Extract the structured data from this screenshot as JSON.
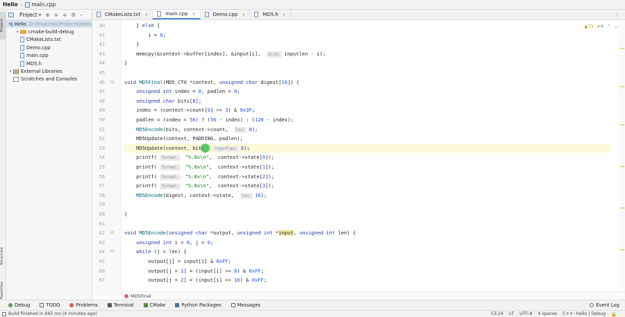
{
  "navbar": {
    "project": "Hello",
    "file": "main.cpp"
  },
  "sidebar_tabs": {
    "project": "Project",
    "structure": "Structure",
    "favorites": "Favorites"
  },
  "project_panel": {
    "title": "Project",
    "tree": [
      {
        "label": "Hello",
        "hint": "D:\\Projects\\CProjects\\Hello",
        "icon": "folder-icon",
        "level": 0,
        "arrow": "▾"
      },
      {
        "label": "cmake-build-debug",
        "icon": "folder-orange-icon",
        "level": 1,
        "arrow": "▸"
      },
      {
        "label": "CMakeLists.txt",
        "icon": "cmake-file-icon",
        "level": 1,
        "arrow": ""
      },
      {
        "label": "Demo.cpp",
        "icon": "cpp-file-icon",
        "level": 1,
        "arrow": ""
      },
      {
        "label": "main.cpp",
        "icon": "cpp-file-icon",
        "level": 1,
        "arrow": ""
      },
      {
        "label": "MD5.h",
        "icon": "header-file-icon",
        "level": 1,
        "arrow": ""
      },
      {
        "label": "External Libraries",
        "icon": "library-icon",
        "level": 0,
        "arrow": "▸"
      },
      {
        "label": "Scratches and Consoles",
        "icon": "scratch-icon",
        "level": 0,
        "arrow": ""
      }
    ]
  },
  "tabs": [
    {
      "label": "CMakeLists.txt",
      "active": false
    },
    {
      "label": "main.cpp",
      "active": true
    },
    {
      "label": "Demo.cpp",
      "active": false
    },
    {
      "label": "MD5.h",
      "active": false
    }
  ],
  "inspections": {
    "warnings": "▲73",
    "ok": "✔6"
  },
  "editor": {
    "line_numbers": [
      "40",
      "41",
      "42",
      "43",
      "44",
      "45",
      "46",
      "47",
      "48",
      "49",
      "50",
      "51",
      "52",
      "53",
      "54",
      "55",
      "56",
      "57",
      "58",
      "59",
      "60",
      "61",
      "62",
      "63",
      "64",
      "65",
      "66",
      "67"
    ],
    "hints": {
      "size": "Size:",
      "len": "len:",
      "inputlen": "inputlen:",
      "format": "format:"
    },
    "code_lines": [
      "    } else {",
      "        i = 0;",
      "    }",
      "    memcpy(&context->buffer[index], &input[i],  inputlen - i);",
      "}",
      "",
      "void MD5Final(MD5_CTX *context, unsigned char digest[16]) {",
      "    unsigned int index = 0, padlen = 0;",
      "    unsigned char bits[8];",
      "    index = (context->count[0] >> 3) & 0x3F;",
      "    padlen = (index < 56) ? (56 - index) : (120 - index);",
      "    MD5Encode(bits, context->count,  8);",
      "    MD5Update(context, PADDING, padlen);",
      "    MD5Update(context, bits,  8);",
      "    printf( \"%.8x\\n\",  context->state[0]);",
      "    printf( \"%.8x\\n\",  context->state[1]);",
      "    printf( \"%.8x\\n\",  context->state[2]);",
      "    printf( \"%.8x\\n\",  context->state[3]);",
      "    MD5Encode(digest, context->state,  16);",
      "",
      "}",
      "",
      "void MD5Encode(unsigned char *output, unsigned int *input, unsigned int len) {",
      "    unsigned int i = 0, j = 0;",
      "    while (j < len) {",
      "        output[j] = input[i] & 0xFF;",
      "        output[j + 1] = (input[i] >> 8) & 0xFF;",
      "        output[j + 2] = (input[i] >> 16) & 0xFF;"
    ],
    "breadcrumb": "MD5Final"
  },
  "toolwindows": [
    {
      "label": "Debug",
      "icon": "debug-icon"
    },
    {
      "label": "TODO",
      "icon": "todo-icon"
    },
    {
      "label": "Problems",
      "icon": "problems-icon"
    },
    {
      "label": "Terminal",
      "icon": "terminal-icon"
    },
    {
      "label": "CMake",
      "icon": "cmake-icon"
    },
    {
      "label": "Python Packages",
      "icon": "python-packages-icon"
    },
    {
      "label": "Messages",
      "icon": "messages-icon"
    }
  ],
  "event_log": "Event Log",
  "status": {
    "message": "Build finished in 665 ms (4 minutes ago)",
    "position": "53:24",
    "line_sep": "LF",
    "encoding": "UTF-8",
    "indent": "4 spaces",
    "context": "C++: Hello | Debug"
  },
  "colors": {
    "accent": "#4a88d8",
    "caret_marker": "#3fbd57",
    "keyword": "#1f34a8",
    "number": "#1750eb",
    "string": "#067d17"
  }
}
